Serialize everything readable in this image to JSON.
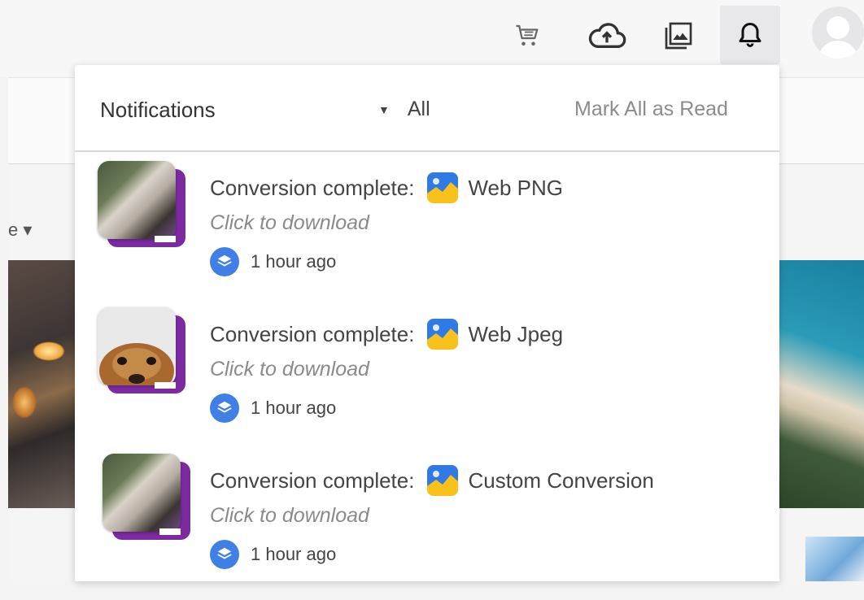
{
  "panel": {
    "title": "Notifications",
    "filter_label": "All",
    "mark_all_label": "Mark All as Read"
  },
  "background": {
    "left_dropdown_fragment": "e"
  },
  "notifications": [
    {
      "message": "Conversion complete:",
      "format": "Web PNG",
      "action": "Click to download",
      "time": "1 hour ago",
      "thumbnail": "person-photo"
    },
    {
      "message": "Conversion complete:",
      "format": "Web Jpeg",
      "action": "Click to download",
      "time": "1 hour ago",
      "thumbnail": "dog-photo"
    },
    {
      "message": "Conversion complete:",
      "format": "Custom Conversion",
      "action": "Click to download",
      "time": "1 hour ago",
      "thumbnail": "person-photo"
    }
  ],
  "icons": {
    "topbar": [
      "cart-icon",
      "cloud-upload-icon",
      "gallery-icon",
      "bell-icon",
      "avatar"
    ],
    "format": "image-format-icon",
    "time": "layers-icon"
  },
  "colors": {
    "time_badge": "#3f7fe6",
    "format_icon_blue": "#2f7ae5",
    "format_icon_yellow": "#f8c21b",
    "thumb_border": "#7b2aa0"
  }
}
